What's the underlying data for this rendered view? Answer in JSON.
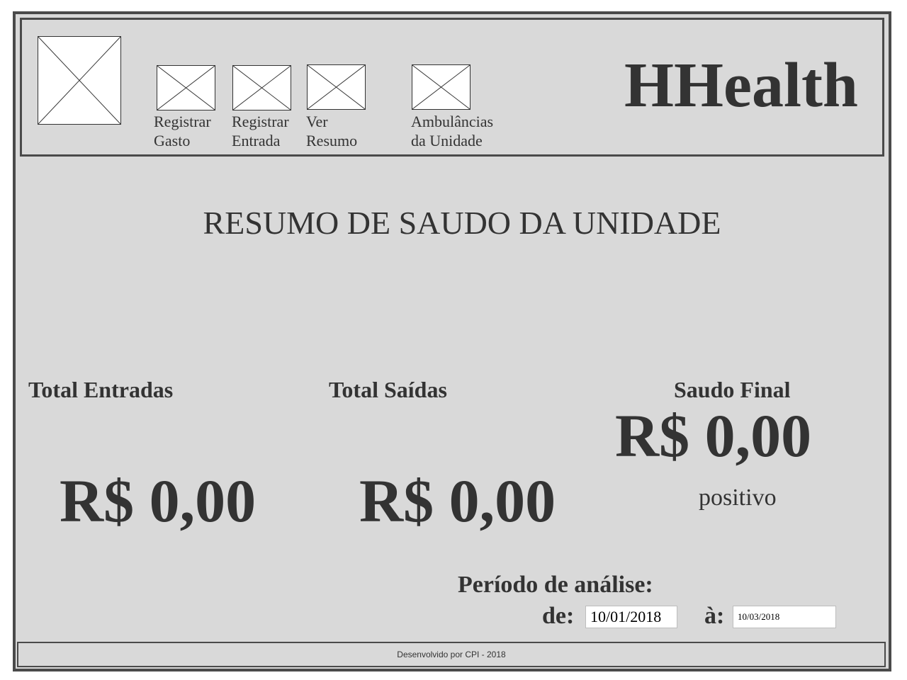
{
  "header": {
    "brand": "HHealth",
    "nav": [
      {
        "label": "Registrar\nGasto"
      },
      {
        "label": "Registrar\nEntrada"
      },
      {
        "label": "Ver\nResumo"
      },
      {
        "label": "Ambulâncias\nda Unidade"
      }
    ]
  },
  "main": {
    "title": "RESUMO DE SAUDO DA UNIDADE",
    "total_entradas": {
      "label": "Total Entradas",
      "value": "R$ 0,00"
    },
    "total_saidas": {
      "label": "Total Saídas",
      "value": "R$ 0,00"
    },
    "saudo_final": {
      "label": "Saudo Final",
      "value": "R$ 0,00",
      "status": "positivo"
    },
    "period": {
      "label": "Período de análise:",
      "from_label": "de:",
      "from_value": "10/01/2018",
      "to_label": "à:",
      "to_value": "10/03/2018"
    }
  },
  "footer": {
    "text": "Desenvolvido por CPI - 2018"
  },
  "colors": {
    "background": "#d9d9d9",
    "border": "#4a4a4a",
    "text": "#333333"
  }
}
